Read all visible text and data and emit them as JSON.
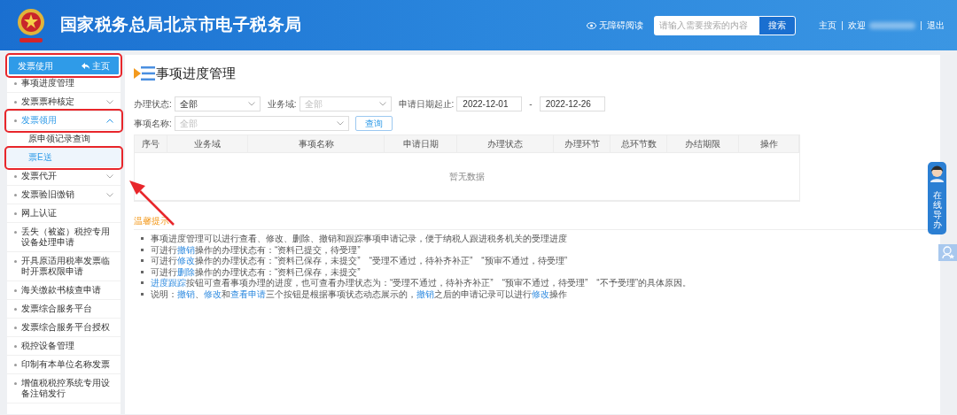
{
  "header": {
    "title": "国家税务总局北京市电子税务局",
    "accessibility": "无障碍阅读",
    "search": {
      "placeholder": "请输入需要搜索的内容"
    },
    "search_button": "搜索",
    "links": [
      {
        "kind": "link",
        "text": "主页"
      },
      {
        "kind": "welcome",
        "text": "欢迎"
      },
      {
        "kind": "link",
        "text": "退出"
      }
    ]
  },
  "sidebar": {
    "title": "发票使用",
    "home": "主页",
    "items": [
      {
        "label": "事项进度管理",
        "kind": "link",
        "selected": false
      },
      {
        "label": "发票票种核定",
        "kind": "group",
        "expanded": false,
        "selected": false
      },
      {
        "label": "发票领用",
        "kind": "group",
        "expanded": true,
        "selected": true,
        "children": [
          {
            "label": "原申领记录查询",
            "selected": false
          },
          {
            "label": "票E送",
            "selected": true
          }
        ]
      },
      {
        "label": "发票代开",
        "kind": "group",
        "expanded": false,
        "selected": false
      },
      {
        "label": "发票验旧缴销",
        "kind": "group",
        "expanded": false,
        "selected": false
      },
      {
        "label": "网上认证",
        "kind": "link",
        "selected": false
      },
      {
        "label": "丢失（被盗）税控专用设备处理申请",
        "kind": "link",
        "selected": false
      },
      {
        "label": "开具原适用税率发票临时开票权限申请",
        "kind": "link",
        "selected": false
      },
      {
        "label": "海关缴款书核查申请",
        "kind": "link",
        "selected": false
      },
      {
        "label": "发票综合服务平台",
        "kind": "link",
        "selected": false
      },
      {
        "label": "发票综合服务平台授权",
        "kind": "link",
        "selected": false
      },
      {
        "label": "税控设备管理",
        "kind": "link",
        "selected": false
      },
      {
        "label": "印制有本单位名称发票",
        "kind": "link",
        "selected": false
      },
      {
        "label": "增值税税控系统专用设备注销发行",
        "kind": "link",
        "selected": false
      }
    ]
  },
  "page": {
    "title": "事项进度管理",
    "filters": [
      {
        "label": "办理状态:",
        "value": "全部",
        "disabled": false
      },
      {
        "label": "业务域:",
        "value": "全部",
        "disabled": true
      }
    ],
    "date_range": {
      "label": "申请日期起止:",
      "from": "2022-12-01",
      "separator": "-",
      "to": "2022-12-26"
    },
    "item_filter": {
      "label": "事项名称:",
      "placeholder": "全部"
    },
    "query_button": "查询",
    "table": {
      "columns": [
        "序号",
        "业务域",
        "事项名称",
        "申请日期",
        "办理状态",
        "办理环节",
        "总环节数",
        "办结期限",
        "操作"
      ],
      "empty": "暂无数据"
    },
    "tips": {
      "title": "温馨提示",
      "lines": [
        [
          {
            "text": "事项进度管理可以进行查看、修改、删除、撤销和跟踪事项申请记录，便于纳税人跟进税务机关的受理进度",
            "link": false
          }
        ],
        [
          {
            "text": "可进行",
            "link": false
          },
          {
            "text": "撤销",
            "link": true
          },
          {
            "text": "操作的办理状态有：“资料已提交，待受理”",
            "link": false
          }
        ],
        [
          {
            "text": "可进行",
            "link": false
          },
          {
            "text": "修改",
            "link": true
          },
          {
            "text": "操作的办理状态有：“资料已保存，未提交”　“受理不通过，待补齐补正”　“预审不通过，待受理”",
            "link": false
          }
        ],
        [
          {
            "text": "可进行",
            "link": false
          },
          {
            "text": "删除",
            "link": true
          },
          {
            "text": "操作的办理状态有：“资料已保存，未提交”",
            "link": false
          }
        ],
        [
          {
            "text": "进度跟踪",
            "link": true
          },
          {
            "text": "按钮可查看事项办理的进度，也可查看办理状态为：“受理不通过，待补齐补正”　“预审不通过，待受理”　“不予受理”的具体原因。",
            "link": false
          }
        ],
        [
          {
            "text": "说明：",
            "link": false
          },
          {
            "text": "撤销",
            "link": true
          },
          {
            "text": "、",
            "link": false
          },
          {
            "text": "修改",
            "link": true
          },
          {
            "text": "和",
            "link": false
          },
          {
            "text": "查看申请",
            "link": true
          },
          {
            "text": "三个按钮是根据事项状态动态展示的，",
            "link": false
          },
          {
            "text": "撤销",
            "link": true
          },
          {
            "text": "之后的申请记录可以进行",
            "link": false
          },
          {
            "text": "修改",
            "link": true
          },
          {
            "text": "操作",
            "link": false
          }
        ]
      ]
    }
  },
  "guide": {
    "label": "在线导办"
  }
}
